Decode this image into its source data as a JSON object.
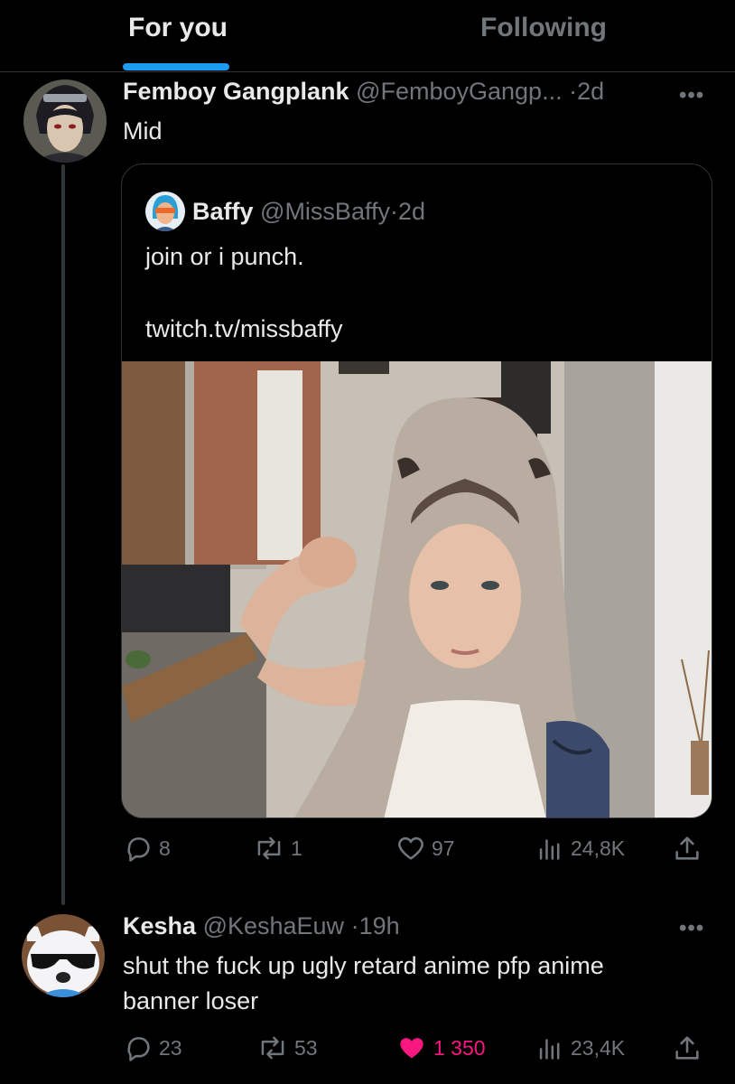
{
  "tabs": [
    {
      "label": "For you",
      "active": true
    },
    {
      "label": "Following",
      "active": false
    }
  ],
  "tweet1": {
    "name": "Femboy Gangplank",
    "handle": "@FemboyGangp...",
    "time": "2d",
    "text": "Mid",
    "quote": {
      "name": "Baffy",
      "handle": "@MissBaffy",
      "time": "2d",
      "text_line1": "join or i punch.",
      "text_line2": "twitch.tv/missbaffy"
    },
    "stats": {
      "replies": "8",
      "reposts": "1",
      "likes": "97",
      "views": "24,8K"
    }
  },
  "tweet2": {
    "name": "Kesha",
    "handle": "@KeshaEuw",
    "time": "19h",
    "text_line1": "shut the fuck up ugly retard anime pfp anime",
    "text_line2": "banner loser",
    "stats": {
      "replies": "23",
      "reposts": "53",
      "likes": "1 350",
      "views": "23,4K",
      "liked": true
    }
  },
  "separator": "·",
  "more_symbol": "•••",
  "colors": {
    "accent": "#1d9bf0",
    "like": "#f91880",
    "muted": "#71767b",
    "border": "#2f3336"
  },
  "icons": [
    "reply-icon",
    "repost-icon",
    "like-icon",
    "views-icon",
    "share-icon",
    "more-icon"
  ]
}
